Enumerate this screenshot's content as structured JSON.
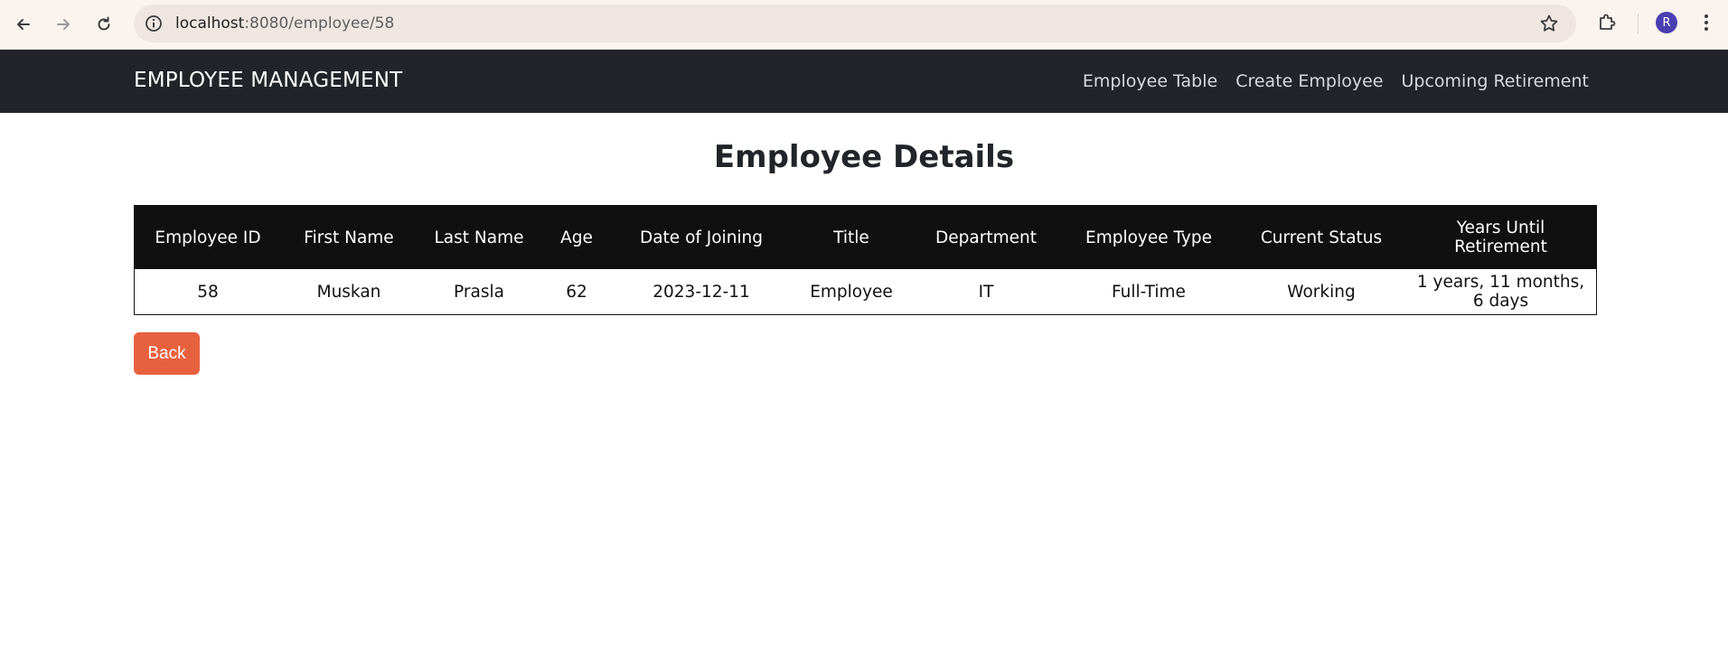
{
  "browser": {
    "url_host": "localhost",
    "url_rest": ":8080/employee/58",
    "profile_initial": "R"
  },
  "navbar": {
    "brand": "EMPLOYEE MANAGEMENT",
    "links": [
      "Employee Table",
      "Create Employee",
      "Upcoming Retirement"
    ]
  },
  "main": {
    "title": "Employee Details",
    "table": {
      "headers": [
        "Employee ID",
        "First Name",
        "Last Name",
        "Age",
        "Date of Joining",
        "Title",
        "Department",
        "Employee Type",
        "Current Status",
        "Years Until Retirement"
      ],
      "rows": [
        [
          "58",
          "Muskan",
          "Prasla",
          "62",
          "2023-12-11",
          "Employee",
          "IT",
          "Full-Time",
          "Working",
          "1 years, 11 months, 6 days"
        ]
      ]
    },
    "back_label": "Back"
  },
  "colors": {
    "navbar_bg": "#212529",
    "table_header_bg": "#101010",
    "back_button": "#e8613f",
    "avatar": "#4a3fb0"
  }
}
